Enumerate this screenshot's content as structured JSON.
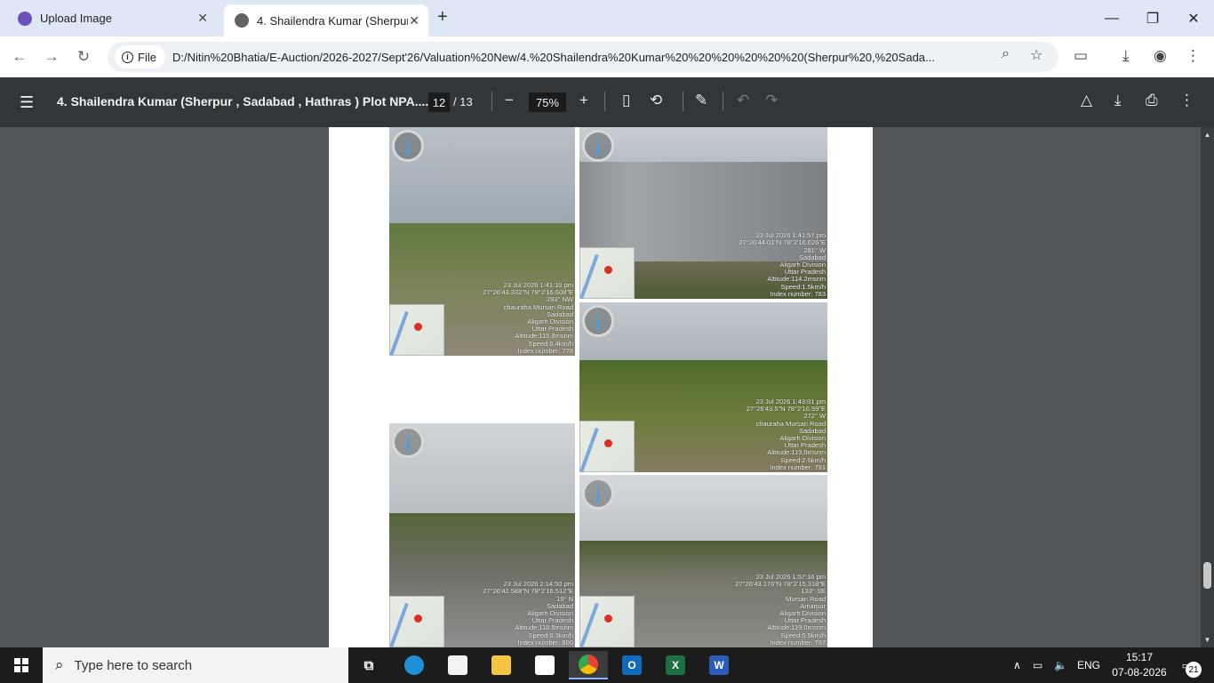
{
  "browser": {
    "tabs": [
      {
        "title": "Upload Image",
        "close": "✕"
      },
      {
        "title": "4. Shailendra Kumar      (Sherpur",
        "close": "✕"
      }
    ],
    "new_tab": "+",
    "window_controls": {
      "minimize": "—",
      "restore": "❐",
      "close": "✕"
    },
    "chip_label": "File",
    "url": "D:/Nitin%20Bhatia/E-Auction/2026-2027/Sept'26/Valuation%20New/4.%20Shailendra%20Kumar%20%20%20%20%20%20(Sherpur%20,%20Sada..."
  },
  "pdf": {
    "title": "4. Shailendra Kumar (Sherpur , Sadabad , Hathras ) Plot NPA....",
    "current_page": "12",
    "total_pages": "/ 13",
    "zoom": "75%",
    "scroll_fraction": 0.88
  },
  "photos": [
    {
      "stamp": [
        "23 Jul 2026 1:41:10 pm",
        "27°26'43.332\"N 78°2'16.608\"E",
        "293° NW",
        "chauraha Mursan Road",
        "Sadabad",
        "Aligarh Division",
        "Uttar Pradesh",
        "Altitude:115.8msnm",
        "Speed:0.4km/h",
        "Index number: 778"
      ]
    },
    {
      "stamp": [
        "23 Jul 2026 1:41:57 pm",
        "27°26'44.01\"N 78°2'16.626\"E",
        "281° W",
        "Sadabad",
        "Aligarh Division",
        "Uttar Pradesh",
        "Altitude:114.2msnm",
        "Speed:1.5km/h",
        "Index number: 783"
      ]
    },
    {
      "stamp": [
        "23 Jul 2026 1:43:01 pm",
        "27°26'43.5\"N 78°2'16.59\"E",
        "272° W",
        "chauraha Mursan Road",
        "Sadabad",
        "Aligarh Division",
        "Uttar Pradesh",
        "Altitude:119.0msnm",
        "Speed:2.6km/h",
        "Index number: 791"
      ]
    },
    {
      "stamp": [
        "23 Jul 2026 2:14:50 pm",
        "27°26'42.588\"N 78°2'16.512\"E",
        "19° N",
        "Sadabad",
        "Aligarh Division",
        "Uttar Pradesh",
        "Altitude:118.5msnm",
        "Speed:0.3km/h",
        "Index number: 800"
      ]
    },
    {
      "stamp": [
        "23 Jul 2026 1:57:16 pm",
        "27°26'43.176\"N 78°2'15.318\"E",
        "133° SE",
        "Mursan Road",
        "Amarpur",
        "Aligarh Division",
        "Uttar Pradesh",
        "Altitude:119.0msnm",
        "Speed:0.5km/h",
        "Index number: 797"
      ]
    }
  ],
  "taskbar": {
    "search_placeholder": "Type here to search",
    "language": "ENG",
    "time": "15:17",
    "date": "07-08-2026",
    "notifications": "21"
  }
}
